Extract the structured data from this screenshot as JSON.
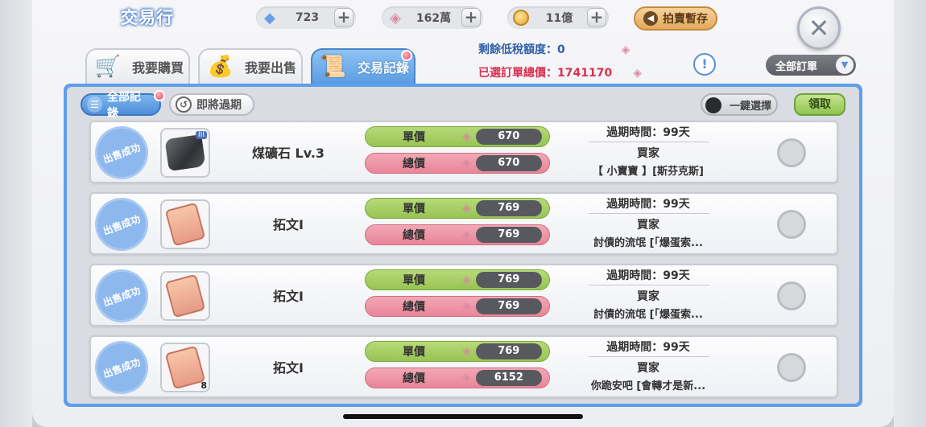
{
  "header": {
    "title": "交易行",
    "resources": [
      {
        "icon": "diamond-icon",
        "value": "723"
      },
      {
        "icon": "shard-icon",
        "value": "162萬"
      },
      {
        "icon": "coin-icon",
        "value": "11億"
      }
    ],
    "auction_button": "拍賣暫存"
  },
  "tabs": [
    {
      "label": "我要購買",
      "icon": "cart-icon"
    },
    {
      "label": "我要出售",
      "icon": "money-bag-icon"
    },
    {
      "label": "交易記錄",
      "icon": "scroll-icon",
      "active": true
    }
  ],
  "tax": {
    "quota_label": "剩餘低稅額度：",
    "quota_value": "0",
    "total_label": "已選訂單總價：",
    "total_value": "1741170"
  },
  "filter_dropdown": "全部訂單",
  "subtabs": {
    "all_records": "全部記錄",
    "expiring": "即將過期"
  },
  "one_click_select": "一鍵選擇",
  "claim_button": "領取",
  "labels": {
    "stamp": "出售成功",
    "unit_price": "單價",
    "total_price": "總價",
    "buyer": "買家"
  },
  "records": [
    {
      "item": "煤礦石 Lv.3",
      "level_badge": "III",
      "qty": "",
      "unit": "670",
      "total": "670",
      "expire": "過期時間：99天",
      "buyer": "【 小寶寶 】[斯芬克斯]"
    },
    {
      "item": "拓文Ⅰ",
      "qty": "",
      "unit": "769",
      "total": "769",
      "expire": "過期時間：99天",
      "buyer": "討債的流氓 [「爆蛋索..."
    },
    {
      "item": "拓文Ⅰ",
      "qty": "",
      "unit": "769",
      "total": "769",
      "expire": "過期時間：99天",
      "buyer": "討債的流氓 [「爆蛋索..."
    },
    {
      "item": "拓文Ⅰ",
      "qty": "8",
      "unit": "769",
      "total": "6152",
      "expire": "過期時間：99天",
      "buyer": "你跪安吧 [會轉才是新..."
    }
  ],
  "colors": {
    "accent_blue": "#5f9ee8",
    "unit_green": "#98c453",
    "total_pink": "#e98598",
    "tax_blue": "#2f5fa8",
    "tax_red": "#d8314f"
  }
}
